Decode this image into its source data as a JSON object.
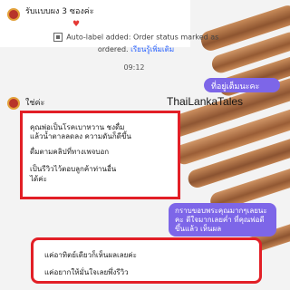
{
  "chat": {
    "messages": [
      {
        "text": "รับแบบผง 3 ซองค่ะ",
        "reaction": "♥"
      },
      {
        "text": "ใช่ค่ะ"
      }
    ],
    "system_notice": {
      "line1": "Auto-label added: Order status marked as",
      "line2_text": "ordered.",
      "learn_more": "เรียนรู้เพิ่มเติม"
    },
    "time": "09:12",
    "outgoing": [
      {
        "text": "ที่อยู่เต็มนะคะ"
      },
      {
        "text": "กราบขอบพระคุณมากๆเลยนะคะ ดีใจมากเลยค่ำ ที่คุณพ่อดีขึ้นแล้ว เห็นผล"
      }
    ],
    "brand": "ThaiLankaTales",
    "highlight_review_1": [
      "คุณพ่อเป็นโรคเบาหวาน ชงดื่ม",
      "แล้วน้ำตาลลดลง ความดันก็ดีขึ้น",
      "ดื่มตามคลิปที่ทางเพจบอก",
      "เป็นรีวิวไว้ตอบลูกค้าท่านอื่น",
      "ได้ค่ะ"
    ],
    "highlight_review_2": [
      "แค่อาทิตย์เดียวก็เห็นผลเลยค่ะ",
      "แค่อยากให้มั่นใจเลยพึ่งรีวิว"
    ]
  },
  "colors": {
    "bubble": "#7d66e8",
    "highlight_border": "#e21f26",
    "background": "#f3f3f3"
  }
}
